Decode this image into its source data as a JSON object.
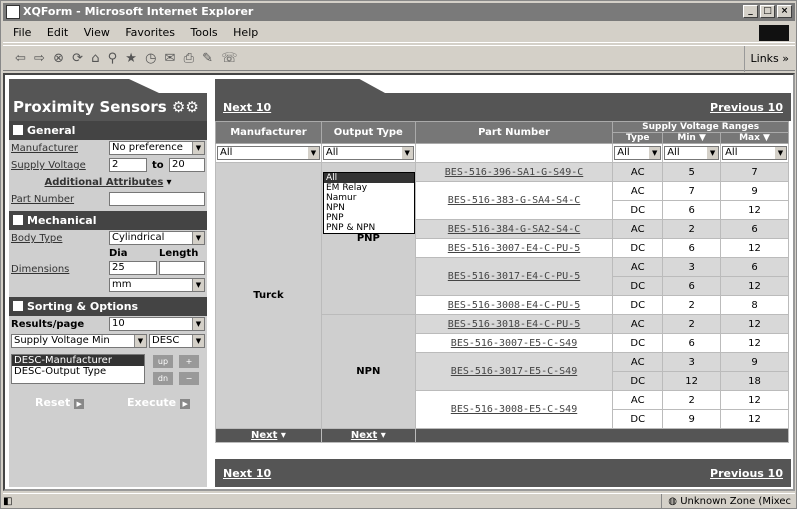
{
  "window": {
    "title": "XQForm - Microsoft Internet Explorer"
  },
  "menu": [
    "File",
    "Edit",
    "View",
    "Favorites",
    "Tools",
    "Help"
  ],
  "toolbar": {
    "links_label": "Links »"
  },
  "sidebar": {
    "title": "Proximity Sensors",
    "general": {
      "heading": "General",
      "manufacturer_label": "Manufacturer",
      "manufacturer_value": "No preference",
      "supply_voltage_label": "Supply Voltage",
      "supply_min": "2",
      "to_label": "to",
      "supply_max": "20",
      "additional_label": "Additional Attributes",
      "part_number_label": "Part Number",
      "part_number_value": ""
    },
    "mechanical": {
      "heading": "Mechanical",
      "body_type_label": "Body Type",
      "body_type_value": "Cylindrical",
      "dia_label": "Dia",
      "length_label": "Length",
      "dimensions_label": "Dimensions",
      "dia_value": "25",
      "length_value": "",
      "unit_value": "mm"
    },
    "sorting": {
      "heading": "Sorting & Options",
      "results_label": "Results/page",
      "results_value": "10",
      "sort_field": "Supply Voltage Min",
      "sort_dir": "DESC",
      "sort_list": [
        "DESC-Manufacturer",
        "DESC-Output Type"
      ],
      "up_label": "up",
      "dn_label": "dn",
      "plus_label": "+",
      "minus_label": "−"
    },
    "reset_label": "Reset",
    "execute_label": "Execute"
  },
  "output_type_dropdown": [
    "All",
    "EM Relay",
    "Namur",
    "NPN",
    "PNP",
    "PNP & NPN"
  ],
  "main": {
    "next_label": "Next 10",
    "prev_label": "Previous 10",
    "headers": {
      "manufacturer": "Manufacturer",
      "output_type": "Output Type",
      "part_number": "Part Number",
      "supply": "Supply Voltage Ranges",
      "type": "Type",
      "min": "Min ▼",
      "max": "Max ▼"
    },
    "filters": {
      "manufacturer": "All",
      "output_type": "All",
      "type": "All",
      "min": "All",
      "max": "All"
    },
    "manufacturer_value": "Turck",
    "groups": [
      {
        "output_type": "PNP",
        "parts": [
          {
            "pn": "BES-516-396-SA1-G-S49-C",
            "rows": [
              {
                "type": "AC",
                "min": "5",
                "max": "7"
              }
            ]
          },
          {
            "pn": "BES-516-383-G-SA4-S4-C",
            "rows": [
              {
                "type": "AC",
                "min": "7",
                "max": "9"
              },
              {
                "type": "DC",
                "min": "6",
                "max": "12"
              }
            ]
          },
          {
            "pn": "BES-516-384-G-SA2-S4-C",
            "rows": [
              {
                "type": "AC",
                "min": "2",
                "max": "6"
              }
            ]
          },
          {
            "pn": "BES-516-3007-E4-C-PU-5",
            "rows": [
              {
                "type": "DC",
                "min": "6",
                "max": "12"
              }
            ]
          },
          {
            "pn": "BES-516-3017-E4-C-PU-5",
            "rows": [
              {
                "type": "AC",
                "min": "3",
                "max": "6"
              },
              {
                "type": "DC",
                "min": "6",
                "max": "12"
              }
            ]
          },
          {
            "pn": "BES-516-3008-E4-C-PU-5",
            "rows": [
              {
                "type": "DC",
                "min": "2",
                "max": "8"
              }
            ]
          }
        ]
      },
      {
        "output_type": "NPN",
        "parts": [
          {
            "pn": "BES-516-3018-E4-C-PU-5",
            "rows": [
              {
                "type": "AC",
                "min": "2",
                "max": "12"
              }
            ]
          },
          {
            "pn": "BES-516-3007-E5-C-S49",
            "rows": [
              {
                "type": "DC",
                "min": "6",
                "max": "12"
              }
            ]
          },
          {
            "pn": "BES-516-3017-E5-C-S49",
            "rows": [
              {
                "type": "AC",
                "min": "3",
                "max": "9"
              },
              {
                "type": "DC",
                "min": "12",
                "max": "18"
              }
            ]
          },
          {
            "pn": "BES-516-3008-E5-C-S49",
            "rows": [
              {
                "type": "AC",
                "min": "2",
                "max": "12"
              },
              {
                "type": "DC",
                "min": "9",
                "max": "12"
              }
            ]
          }
        ]
      }
    ],
    "col_next": "Next"
  },
  "status": {
    "zone": "Unknown Zone (Mixec"
  }
}
